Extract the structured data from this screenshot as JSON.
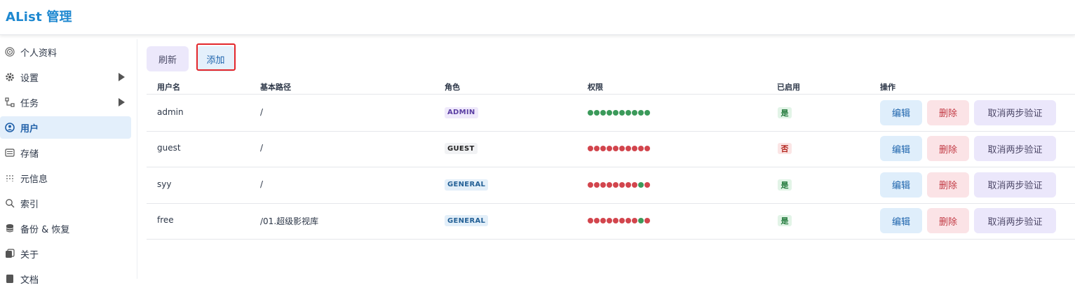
{
  "app": {
    "title": "AList 管理"
  },
  "sidebar": {
    "items": [
      {
        "label": "个人资料",
        "icon": "fingerprint-icon",
        "has_arrow": false,
        "active": false
      },
      {
        "label": "设置",
        "icon": "gear-icon",
        "has_arrow": true,
        "active": false
      },
      {
        "label": "任务",
        "icon": "workflow-icon",
        "has_arrow": true,
        "active": false
      },
      {
        "label": "用户",
        "icon": "user-circle-icon",
        "has_arrow": false,
        "active": true
      },
      {
        "label": "存储",
        "icon": "storage-icon",
        "has_arrow": false,
        "active": false
      },
      {
        "label": "元信息",
        "icon": "grid-icon",
        "has_arrow": false,
        "active": false
      },
      {
        "label": "索引",
        "icon": "search-icon",
        "has_arrow": false,
        "active": false
      },
      {
        "label": "备份 & 恢复",
        "icon": "database-icon",
        "has_arrow": false,
        "active": false
      },
      {
        "label": "关于",
        "icon": "copy-icon",
        "has_arrow": false,
        "active": false
      },
      {
        "label": "文档",
        "icon": "document-icon",
        "has_arrow": false,
        "active": false
      }
    ]
  },
  "toolbar": {
    "refresh_label": "刷新",
    "add_label": "添加"
  },
  "table": {
    "headers": {
      "username": "用户名",
      "base_path": "基本路径",
      "role": "角色",
      "permissions": "权限",
      "enabled": "已启用",
      "actions": "操作"
    },
    "rows": [
      {
        "username": "admin",
        "base_path": "/",
        "role": "ADMIN",
        "role_style": "admin",
        "permissions": [
          "g",
          "g",
          "g",
          "g",
          "g",
          "g",
          "g",
          "g",
          "g",
          "g"
        ],
        "enabled": "是",
        "enabled_style": "yes"
      },
      {
        "username": "guest",
        "base_path": "/",
        "role": "GUEST",
        "role_style": "guest",
        "permissions": [
          "r",
          "r",
          "r",
          "r",
          "r",
          "r",
          "r",
          "r",
          "r",
          "r"
        ],
        "enabled": "否",
        "enabled_style": "no"
      },
      {
        "username": "syy",
        "base_path": "/",
        "role": "GENERAL",
        "role_style": "general",
        "permissions": [
          "r",
          "r",
          "r",
          "r",
          "r",
          "r",
          "r",
          "r",
          "g",
          "r"
        ],
        "enabled": "是",
        "enabled_style": "yes"
      },
      {
        "username": "free",
        "base_path": "/01.超级影视库",
        "role": "GENERAL",
        "role_style": "general",
        "permissions": [
          "r",
          "r",
          "r",
          "r",
          "r",
          "r",
          "r",
          "r",
          "g",
          "r"
        ],
        "enabled": "是",
        "enabled_style": "yes"
      }
    ],
    "actions": {
      "edit": "编辑",
      "delete": "删除",
      "cancel_2fa": "取消两步验证"
    }
  },
  "colors": {
    "permission_on": "#3b9a5a",
    "permission_off": "#d2454d",
    "accent": "#1e88d0"
  }
}
